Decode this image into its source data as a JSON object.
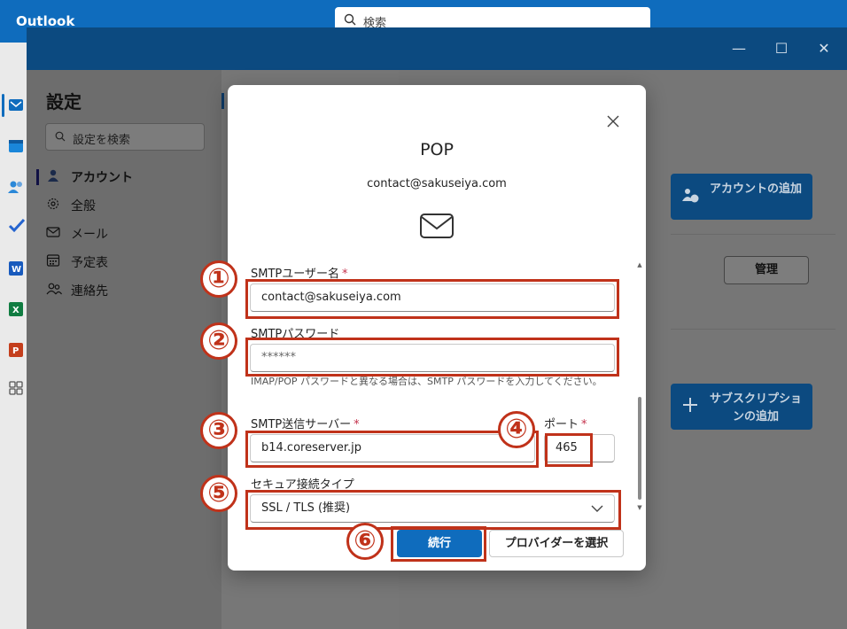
{
  "app": {
    "title": "Outlook",
    "search_placeholder": "検索"
  },
  "settings": {
    "title": "設定",
    "search_placeholder": "設定を検索",
    "nav": [
      {
        "label": "アカウント",
        "icon": "person-icon",
        "active": true
      },
      {
        "label": "全般",
        "icon": "gear-icon"
      },
      {
        "label": "メール",
        "icon": "mail-icon"
      },
      {
        "label": "予定表",
        "icon": "calendar-icon"
      },
      {
        "label": "連絡先",
        "icon": "contacts-icon"
      }
    ],
    "add_account_label": "アカウントの追加",
    "manage_label": "管理",
    "add_subscription_label": "サブスクリプションの追加"
  },
  "dialog": {
    "title": "POP",
    "email": "contact@sakuseiya.com",
    "smtp_username": {
      "label": "SMTPユーザー名",
      "required": "*",
      "value": "contact@sakuseiya.com"
    },
    "smtp_password": {
      "label": "SMTPパスワード",
      "value": "******"
    },
    "help_text": "IMAP/POP パスワードと異なる場合は、SMTP パスワードを入力してください。",
    "smtp_server": {
      "label": "SMTP送信サーバー",
      "required": "*",
      "value": "b14.coreserver.jp"
    },
    "port": {
      "label": "ポート",
      "required": "*",
      "value": "465"
    },
    "secure_type": {
      "label": "セキュア接続タイプ",
      "value": "SSL / TLS (推奨)"
    },
    "continue_label": "続行",
    "provider_label": "プロバイダーを選択"
  },
  "annotations": [
    "①",
    "②",
    "③",
    "④",
    "⑤",
    "⑥"
  ],
  "colors": {
    "brand": "#0f6cbd",
    "annotation_red": "#c0321a",
    "required_red": "#c4314b"
  }
}
